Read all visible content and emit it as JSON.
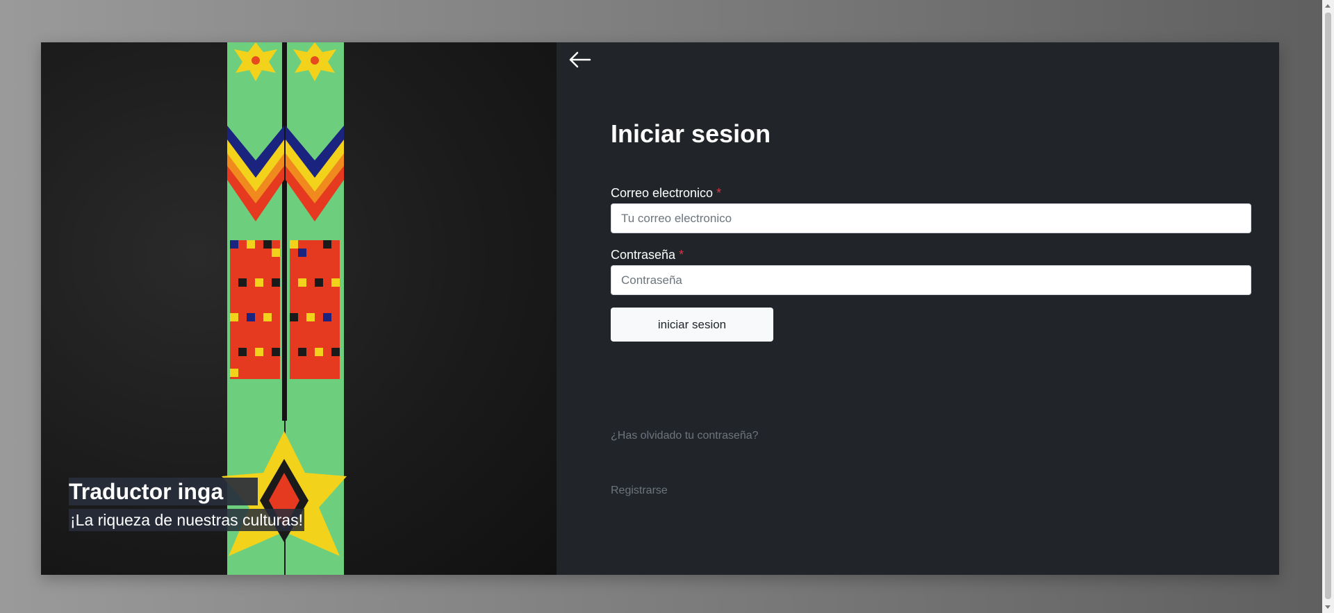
{
  "hero": {
    "title": "Traductor inga",
    "subtitle": "¡La riqueza de nuestras culturas!",
    "image_icon": "beadwork-image"
  },
  "login": {
    "back_icon": "arrow-left-icon",
    "title": "Iniciar sesion",
    "email_label": "Correo electronico",
    "email_placeholder": "Tu correo electronico",
    "email_value": "",
    "password_label": "Contraseña",
    "password_placeholder": "Contraseña",
    "password_value": "",
    "required_marker": "*",
    "submit_label": "iniciar sesion",
    "forgot_link": "¿Has olvidado tu contraseña?",
    "register_link": "Registrarse"
  },
  "colors": {
    "panel_bg": "#212529",
    "required": "#dc3545",
    "link": "#6c757d",
    "button_bg": "#f8f9fa"
  }
}
